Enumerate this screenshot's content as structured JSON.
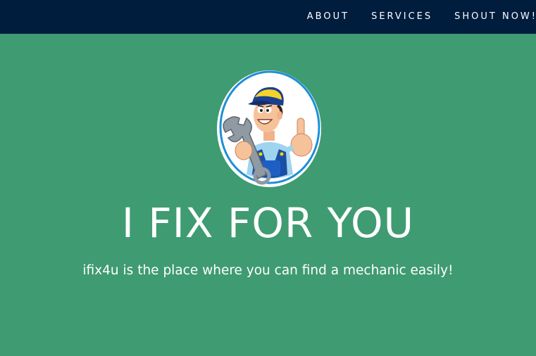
{
  "nav": {
    "items": [
      {
        "label": "ABOUT"
      },
      {
        "label": "SERVICES"
      },
      {
        "label": "SHOUT NOW!"
      }
    ]
  },
  "hero": {
    "logo_icon": "mechanic-with-wrench-icon",
    "title": "I FIX FOR YOU",
    "subtitle": "ifix4u is the place where you can find a mechanic easily!"
  },
  "colors": {
    "navbar_bg": "#001d3e",
    "hero_bg": "#3f9b71",
    "text": "#ffffff",
    "logo_ring": "#1e8fd6"
  }
}
